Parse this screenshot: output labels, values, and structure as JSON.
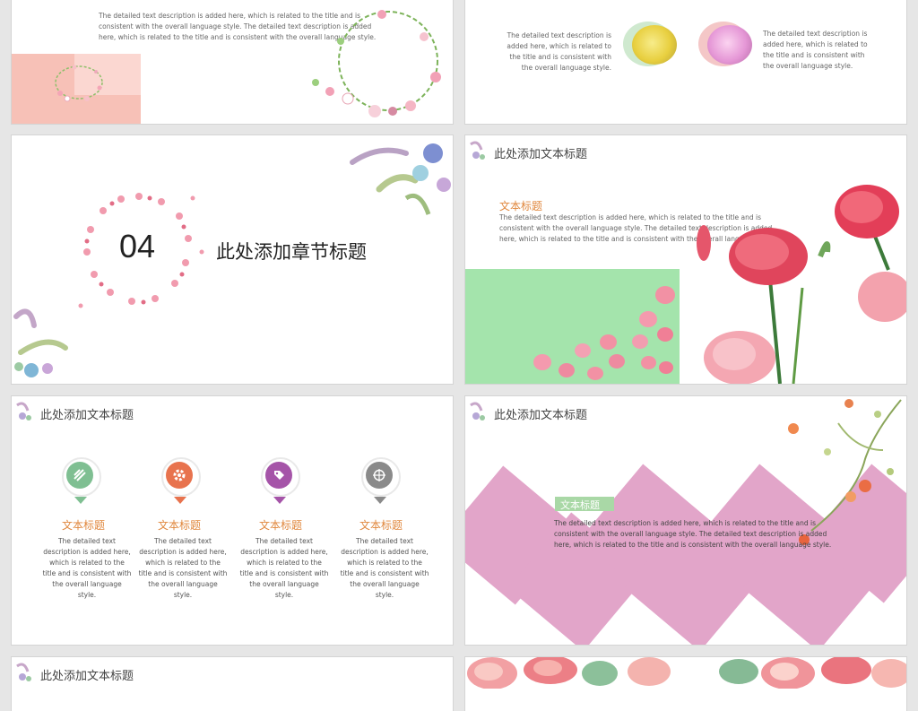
{
  "slide1": {
    "text": "The detailed text description is added here, which is related to the title and is consistent with the overall language style. The detailed text description is added here, which is related to the title and is consistent with the overall language style."
  },
  "slide2": {
    "left_text": "The detailed text description is added here, which is related to the title and is consistent with the overall language style.",
    "right_text": "The detailed text description is added here, which is related to the title and is consistent with the overall language style."
  },
  "slide3": {
    "number": "04",
    "chapter_title": "此处添加章节标题"
  },
  "slide4": {
    "header": "此处添加文本标题",
    "subtitle": "文本标题",
    "text": "The detailed text description is added here, which is related to the title and is consistent with the overall language style. The detailed text description is added here, which is related to the title and is consistent with the overall language style."
  },
  "slide5": {
    "header": "此处添加文本标题",
    "columns": [
      {
        "title": "文本标题",
        "text": "The detailed text description is added here, which is related to the title and is consistent with the overall language style.",
        "color": "#7fbf92",
        "icon": "lines-icon"
      },
      {
        "title": "文本标题",
        "text": "The detailed text description is added here, which is related to the title and is consistent with the overall language style.",
        "color": "#e8734e",
        "icon": "gear-icon"
      },
      {
        "title": "文本标题",
        "text": "The detailed text description is added here, which is related to the title and is consistent with the overall language style.",
        "color": "#a554a8",
        "icon": "tag-icon"
      },
      {
        "title": "文本标题",
        "text": "The detailed text description is added here, which is related to the title and is consistent with the overall language style.",
        "color": "#8a8a8a",
        "icon": "target-icon"
      }
    ]
  },
  "slide6": {
    "header": "此处添加文本标题",
    "subtitle": "文本标题",
    "text": "The detailed text description is added here, which is related to the title and is consistent with the overall language style. The detailed text description is added here, which is related to the title and is consistent with the overall language style."
  },
  "slide7": {
    "header": "此处添加文本标题"
  },
  "colors": {
    "pink_block": "#f5b8ae",
    "green_block": "#a4e4ac",
    "diamond": "#e2a5c9",
    "accent_orange": "#e0873d"
  }
}
